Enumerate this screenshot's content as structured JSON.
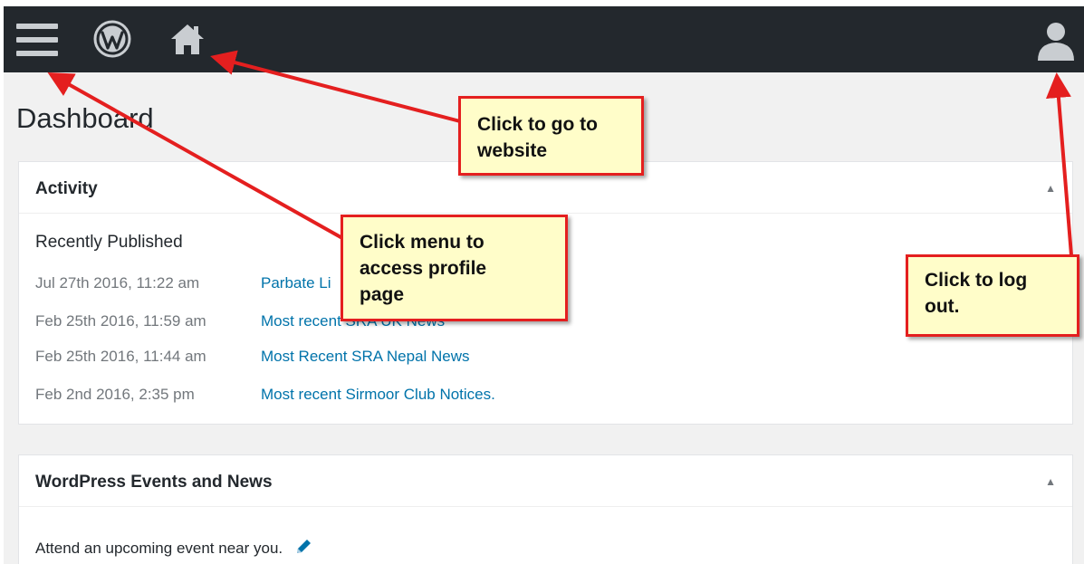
{
  "page": {
    "title": "Dashboard"
  },
  "toolbar": {
    "menu_icon": "hamburger-menu-icon",
    "wp_icon": "wordpress-logo-icon",
    "home_icon": "home-icon",
    "user_icon": "user-icon"
  },
  "activity": {
    "title": "Activity",
    "section_label": "Recently Published",
    "items": [
      {
        "date": "Jul 27th 2016, 11:22 am",
        "link": "Parbate Li"
      },
      {
        "date": "Feb 25th 2016, 11:59 am",
        "link": "Most recent SRA UK News"
      },
      {
        "date": "Feb 25th 2016, 11:44 am",
        "link": "Most Recent SRA Nepal News"
      },
      {
        "date": "Feb 2nd 2016, 2:35 pm",
        "link": "Most recent Sirmoor Club Notices."
      }
    ]
  },
  "events": {
    "title": "WordPress Events and News",
    "text": "Attend an upcoming event near you."
  },
  "callouts": {
    "website": [
      "Click to go to",
      "website"
    ],
    "menu": [
      "Click menu to",
      "access profile",
      "page"
    ],
    "logout": [
      "Click to log",
      "out."
    ]
  },
  "colors": {
    "admin_bar": "#23282d",
    "link": "#0073aa",
    "callout_fill": "#fffdc9",
    "arrow": "#e41f1f"
  }
}
